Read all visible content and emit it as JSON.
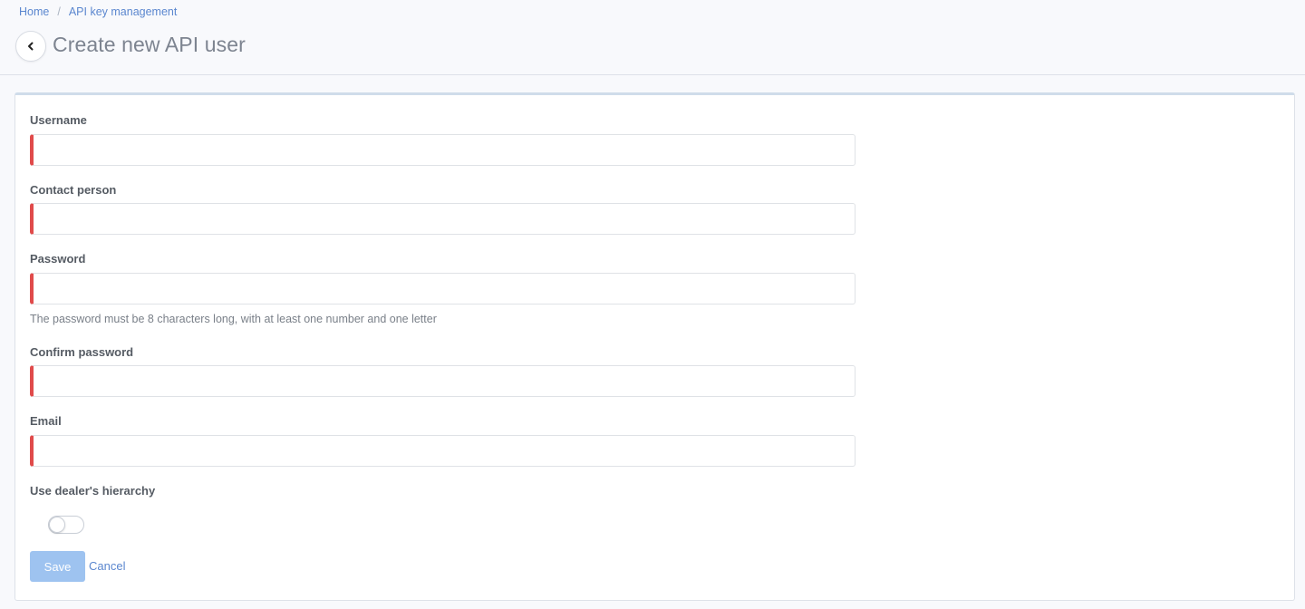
{
  "breadcrumb": {
    "home": "Home",
    "separator": "/",
    "current": "API key management"
  },
  "page": {
    "title": "Create new API user"
  },
  "icons": {
    "back": "chevron-left-icon"
  },
  "form": {
    "username": {
      "label": "Username",
      "value": ""
    },
    "contact_person": {
      "label": "Contact person",
      "value": ""
    },
    "password": {
      "label": "Password",
      "value": "",
      "help": "The password must be 8 characters long, with at least one number and one letter"
    },
    "confirm_password": {
      "label": "Confirm password",
      "value": ""
    },
    "email": {
      "label": "Email",
      "value": ""
    },
    "dealer_hierarchy": {
      "label": "Use dealer's hierarchy",
      "enabled": false
    }
  },
  "actions": {
    "save": "Save",
    "cancel": "Cancel"
  },
  "colors": {
    "required_marker": "#e04b4b",
    "save_button": "#9ec3f0",
    "link": "#5b87cf"
  }
}
